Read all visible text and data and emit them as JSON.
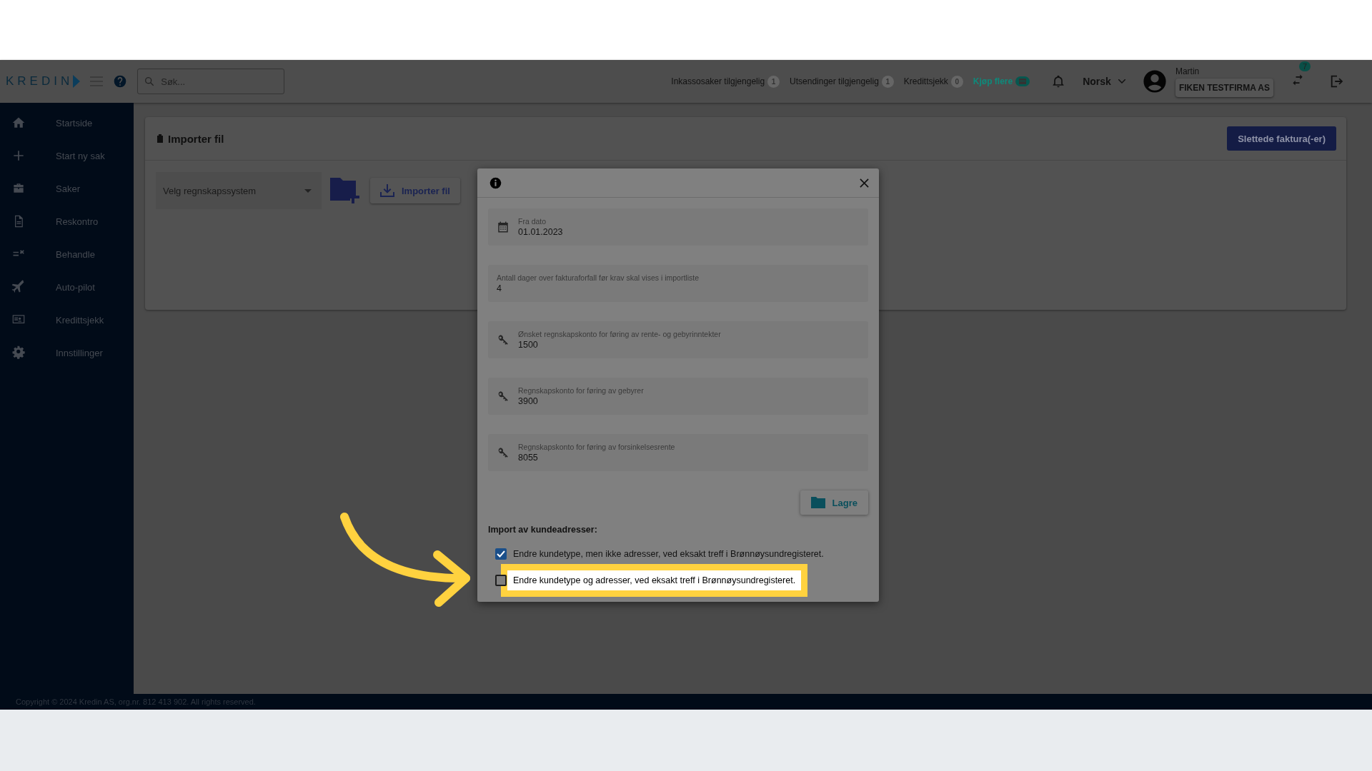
{
  "header": {
    "logo": "KREDIN",
    "search": {
      "placeholder": "Søk..."
    },
    "counters": [
      {
        "label": "Inkassosaker tilgjengelig",
        "count": "1"
      },
      {
        "label": "Utsendinger tilgjengelig",
        "count": "1"
      },
      {
        "label": "Kredittsjekk",
        "count": "0"
      }
    ],
    "buy_more": "Kjøp flere",
    "language": "Norsk",
    "user": {
      "name": "Martin",
      "company": "FIKEN TESTFIRMA AS"
    },
    "swap_badge": "7"
  },
  "sidebar": {
    "items": [
      {
        "label": "Startside"
      },
      {
        "label": "Start ny sak"
      },
      {
        "label": "Saker"
      },
      {
        "label": "Reskontro"
      },
      {
        "label": "Behandle"
      },
      {
        "label": "Auto-pilot"
      },
      {
        "label": "Kredittsjekk"
      },
      {
        "label": "Innstillinger"
      }
    ]
  },
  "page": {
    "title": "Importer fil",
    "delete_button": "Slettede faktura(-er)",
    "select": {
      "placeholder": "Velg regnskapssystem"
    },
    "import_button": "Importer fil"
  },
  "modal": {
    "fields": [
      {
        "kind": "date",
        "label": "Fra dato",
        "value": "01.01.2023"
      },
      {
        "kind": "plain",
        "label": "Antall dager over fakturaforfall før krav skal vises i importliste",
        "value": "4"
      },
      {
        "kind": "key",
        "label": "Ønsket regnskapskonto for føring av rente- og gebyrinntekter",
        "value": "1500"
      },
      {
        "kind": "key",
        "label": "Regnskapskonto for føring av gebyrer",
        "value": "3900"
      },
      {
        "kind": "key",
        "label": "Regnskapskonto for føring av forsinkelsesrente",
        "value": "8055"
      }
    ],
    "save_button": "Lagre",
    "section_title": "Import av kundeadresser:",
    "options": [
      {
        "label": "Endre kundetype, men ikke adresser, ved eksakt treff i Brønnøysundregisteret.",
        "checked": true,
        "highlighted": false
      },
      {
        "label": "Endre kundetype og adresser, ved eksakt treff i Brønnøysundregisteret.",
        "checked": false,
        "highlighted": true
      }
    ]
  },
  "footer": {
    "copyright": "Copyright © 2024 Kredin AS, org.nr. 812 413 902. All rights reserved."
  }
}
